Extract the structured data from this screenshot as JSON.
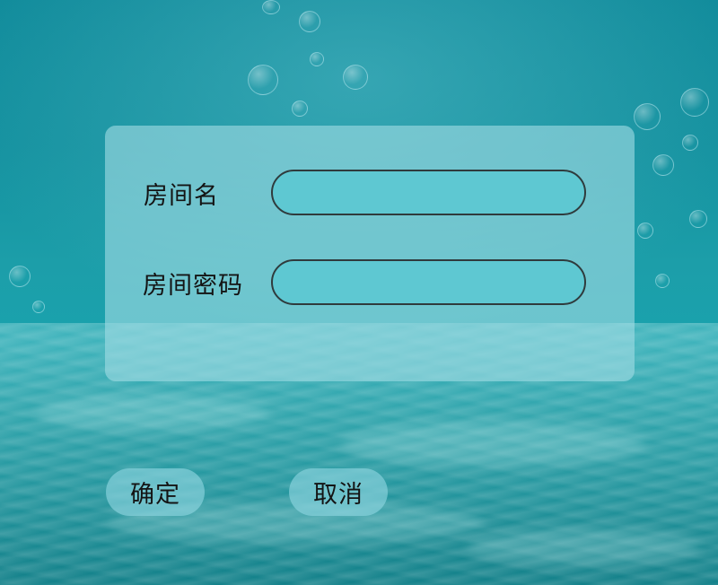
{
  "dialog": {
    "room_name_label": "房间名",
    "room_name_value": "",
    "room_password_label": "房间密码",
    "room_password_value": ""
  },
  "actions": {
    "confirm_label": "确定",
    "cancel_label": "取消"
  },
  "colors": {
    "background": "#149aa6",
    "panel": "#a0dce4",
    "input_fill": "#5ec8d2",
    "input_border": "#2f3b3d",
    "button_fill": "#8cd4de"
  }
}
